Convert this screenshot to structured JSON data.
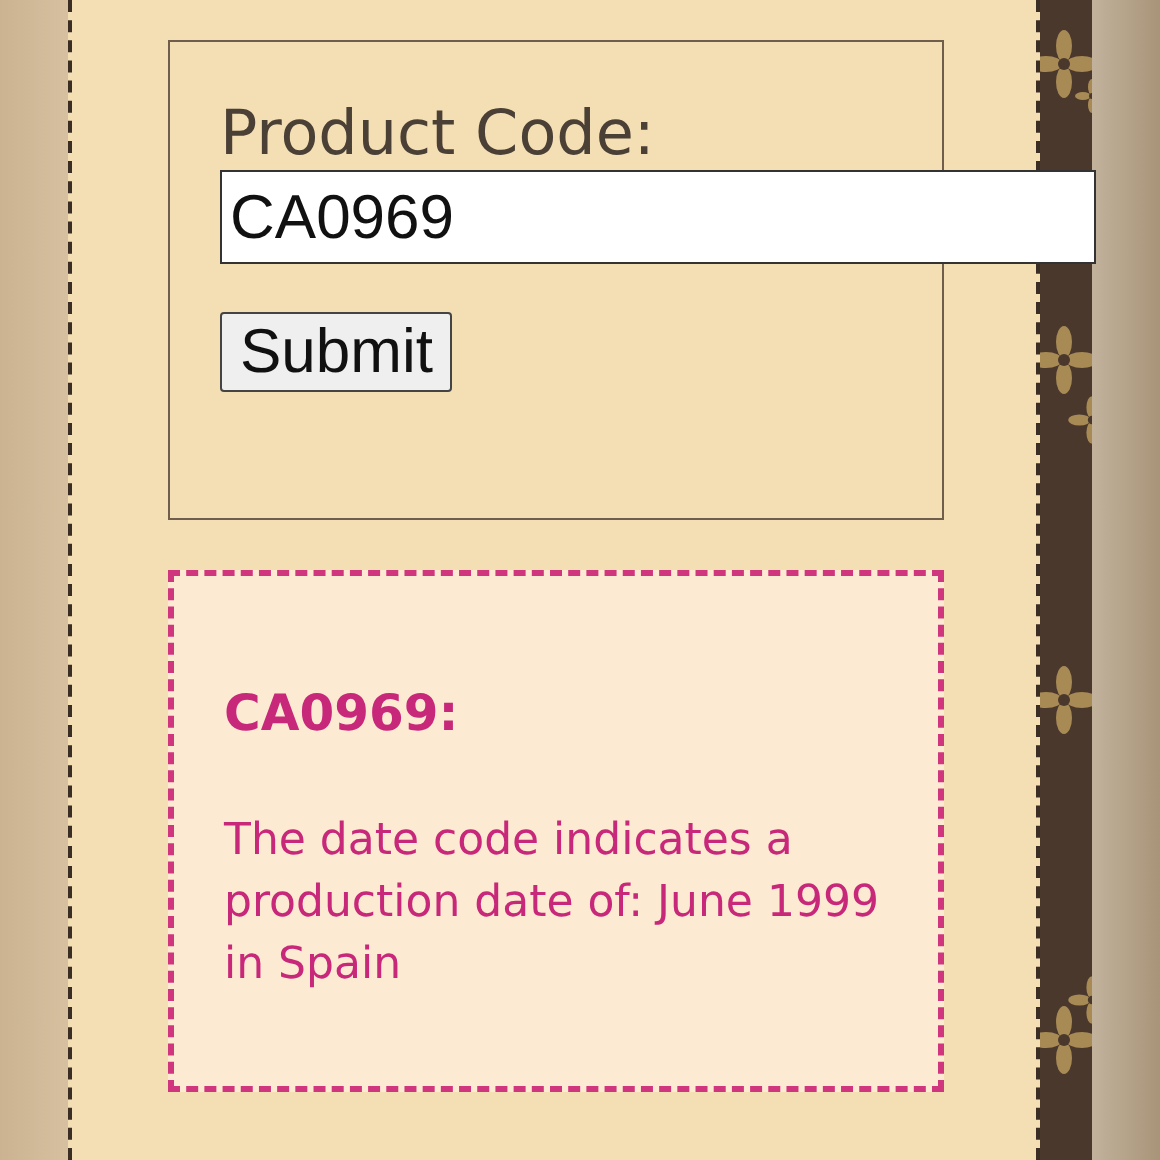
{
  "form": {
    "label": "Product Code:",
    "input_value": "CA0969",
    "submit": "Submit"
  },
  "result": {
    "title": "CA0969:",
    "message": "The date code indicates a production date of: June 1999 in Spain"
  }
}
